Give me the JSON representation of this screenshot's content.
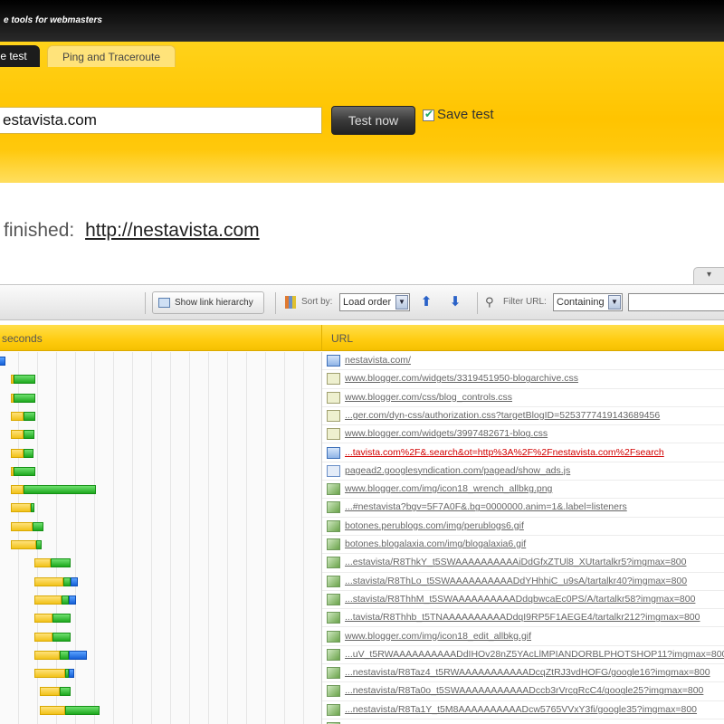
{
  "header": {
    "tagline": "e tools for webmasters"
  },
  "tabs": [
    {
      "label": "e test",
      "active": true
    },
    {
      "label": "Ping and Traceroute",
      "active": false
    }
  ],
  "test_form": {
    "url_value": "estavista.com",
    "button_label": "Test now",
    "save_label": "Save test",
    "save_checked": true
  },
  "status": {
    "text": "finished:",
    "url": "http://nestavista.com"
  },
  "toolbar": {
    "hierarchy_label": "Show link hierarchy",
    "sort_label": "Sort by:",
    "sort_value": "Load order",
    "filter_label": "Filter URL:",
    "filter_value": "Containing",
    "filter_text": ""
  },
  "columns": {
    "timeline": "seconds",
    "url": "URL"
  },
  "colors": {
    "yellow": "#ffc400",
    "green": "#1ea81e",
    "blue": "#1560d8",
    "error_red": "#d20000"
  },
  "rows": [
    {
      "url": "nestavista.com/",
      "icon": "html",
      "error": false,
      "segments": [
        [
          "b",
          -2,
          8
        ]
      ]
    },
    {
      "url": "www.blogger.com/widgets/3319451950-blogarchive.css",
      "icon": "css",
      "error": false,
      "segments": [
        [
          "y",
          12,
          3
        ],
        [
          "g",
          15,
          24
        ]
      ]
    },
    {
      "url": "www.blogger.com/css/blog_controls.css",
      "icon": "css",
      "error": false,
      "segments": [
        [
          "y",
          12,
          3
        ],
        [
          "g",
          15,
          24
        ]
      ]
    },
    {
      "url": "...ger.com/dyn-css/authorization.css?targetBlogID=5253777419143689456",
      "icon": "css",
      "error": false,
      "segments": [
        [
          "y",
          12,
          14
        ],
        [
          "g",
          26,
          13
        ]
      ]
    },
    {
      "url": "www.blogger.com/widgets/3997482671-blog.css",
      "icon": "css",
      "error": false,
      "segments": [
        [
          "y",
          12,
          14
        ],
        [
          "g",
          26,
          12
        ]
      ]
    },
    {
      "url": "...tavista.com%2F&.search&ot=http%3A%2F%2Fnestavista.com%2Fsearch",
      "icon": "html",
      "error": true,
      "segments": [
        [
          "y",
          12,
          14
        ],
        [
          "g",
          26,
          11
        ]
      ]
    },
    {
      "url": "pagead2.googlesyndication.com/pagead/show_ads.js",
      "icon": "js",
      "error": false,
      "segments": [
        [
          "y",
          12,
          3
        ],
        [
          "g",
          15,
          24
        ]
      ]
    },
    {
      "url": "www.blogger.com/img/icon18_wrench_allbkg.png",
      "icon": "img",
      "error": false,
      "segments": [
        [
          "y",
          12,
          14
        ],
        [
          "g",
          26,
          80
        ]
      ]
    },
    {
      "url": "...#nestavista?bgv=5F7A0F&.bg=0000000.anim=1&.label=listeners",
      "icon": "img",
      "error": false,
      "segments": [
        [
          "y",
          12,
          22
        ],
        [
          "g",
          34,
          4
        ]
      ]
    },
    {
      "url": "botones.perublogs.com/img/perublogs6.gif",
      "icon": "img",
      "error": false,
      "segments": [
        [
          "y",
          12,
          24
        ],
        [
          "g",
          36,
          12
        ]
      ]
    },
    {
      "url": "botones.blogalaxia.com/img/blogalaxia6.gif",
      "icon": "img",
      "error": false,
      "segments": [
        [
          "y",
          12,
          28
        ],
        [
          "g",
          40,
          6
        ]
      ]
    },
    {
      "url": "...estavista/R8ThkY_t5SWAAAAAAAAAAiDdGfxZTUl8_XUtartalkr5?imgmax=800",
      "icon": "img",
      "error": false,
      "segments": [
        [
          "y",
          38,
          18
        ],
        [
          "g",
          56,
          22
        ]
      ]
    },
    {
      "url": "...stavista/R8ThLo_t5SWAAAAAAAAAADdYHhhiC_u9sA/tartalkr40?imgmax=800",
      "icon": "img",
      "error": false,
      "segments": [
        [
          "y",
          38,
          32
        ],
        [
          "g",
          70,
          8
        ],
        [
          "b",
          78,
          8
        ]
      ]
    },
    {
      "url": "...stavista/R8ThhM_t5SWAAAAAAAAAADdqbwcaEc0PS/A/tartalkr58?imgmax=800",
      "icon": "img",
      "error": false,
      "segments": [
        [
          "y",
          38,
          30
        ],
        [
          "g",
          68,
          8
        ],
        [
          "b",
          76,
          8
        ]
      ]
    },
    {
      "url": "...tavista/R8Thhb_t5TNAAAAAAAAAADdqI9RP5F1AEGE4/tartalkr212?imgmax=800",
      "icon": "img",
      "error": false,
      "segments": [
        [
          "y",
          38,
          20
        ],
        [
          "g",
          58,
          20
        ]
      ]
    },
    {
      "url": "www.blogger.com/img/icon18_edit_allbkg.gif",
      "icon": "img",
      "error": false,
      "segments": [
        [
          "y",
          38,
          20
        ],
        [
          "g",
          58,
          20
        ]
      ]
    },
    {
      "url": "...uV_t5RWAAAAAAAAAADdIHOv28nZ5YAcLlMPIANDORBLPHOTSHOP11?imgmax=800",
      "icon": "img",
      "error": false,
      "segments": [
        [
          "y",
          38,
          28
        ],
        [
          "g",
          66,
          10
        ],
        [
          "b",
          76,
          20
        ]
      ]
    },
    {
      "url": "...nestavista/R8Taz4_t5RWAAAAAAAAAAADcqZtRJ3vdHOFG/google16?imgmax=800",
      "icon": "img",
      "error": false,
      "segments": [
        [
          "y",
          38,
          34
        ],
        [
          "g",
          72,
          4
        ],
        [
          "b",
          76,
          6
        ]
      ]
    },
    {
      "url": "...nestavista/R8Ta0o_t5SWAAAAAAAAAAADccb3rVrcgRcC4/google25?imgmax=800",
      "icon": "img",
      "error": false,
      "segments": [
        [
          "y",
          44,
          22
        ],
        [
          "g",
          66,
          12
        ]
      ]
    },
    {
      "url": "...nestavista/R8Ta1Y_t5M8AAAAAAAAAADcw5765VVxY3fi/google35?imgmax=800",
      "icon": "img",
      "error": false,
      "segments": [
        [
          "y",
          44,
          28
        ],
        [
          "g",
          72,
          38
        ]
      ]
    },
    {
      "url": "",
      "icon": "img",
      "error": false,
      "segments": [
        [
          "b",
          80,
          18
        ]
      ]
    }
  ]
}
